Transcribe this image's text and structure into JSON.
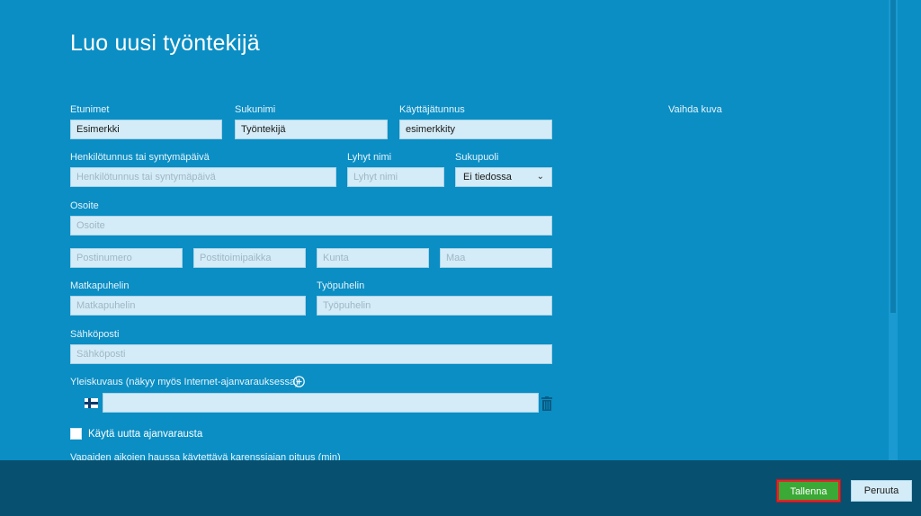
{
  "page": {
    "title": "Luo uusi työntekijä"
  },
  "form": {
    "first_name": {
      "label": "Etunimet",
      "value": "Esimerkki"
    },
    "last_name": {
      "label": "Sukunimi",
      "value": "Työntekijä"
    },
    "username": {
      "label": "Käyttäjätunnus",
      "value": "esimerkkity"
    },
    "ssn": {
      "label": "Henkilötunnus tai syntymäpäivä",
      "placeholder": "Henkilötunnus tai syntymäpäivä"
    },
    "short_name": {
      "label": "Lyhyt nimi",
      "placeholder": "Lyhyt nimi"
    },
    "gender": {
      "label": "Sukupuoli",
      "value": "Ei tiedossa"
    },
    "address": {
      "label": "Osoite",
      "placeholder": "Osoite"
    },
    "postal_code": {
      "placeholder": "Postinumero"
    },
    "city": {
      "placeholder": "Postitoimipaikka"
    },
    "municipality": {
      "placeholder": "Kunta"
    },
    "country": {
      "placeholder": "Maa"
    },
    "mobile": {
      "label": "Matkapuhelin",
      "placeholder": "Matkapuhelin"
    },
    "work_phone": {
      "label": "Työpuhelin",
      "placeholder": "Työpuhelin"
    },
    "email": {
      "label": "Sähköposti",
      "placeholder": "Sähköposti"
    },
    "description": {
      "label": "Yleiskuvaus (näkyy myös Internet-ajanvarauksessa)"
    },
    "new_booking": {
      "label": "Käytä uutta ajanvarausta",
      "checked": false
    },
    "buffer_label": "Vapaiden aikojen haussa käytettävä karenssiajan pituus (min)"
  },
  "side": {
    "change_photo": "Vaihda kuva"
  },
  "footer": {
    "save_label": "Tallenna",
    "cancel_label": "Peruuta"
  },
  "colors": {
    "background": "#0a8ec4",
    "footer": "#08506f",
    "save": "#3aa935",
    "highlight": "#e0242a"
  },
  "icons": {
    "add": "plus-circle-icon",
    "language": "finland-flag-icon",
    "delete": "trash-icon",
    "dropdown": "chevron-down-icon"
  }
}
